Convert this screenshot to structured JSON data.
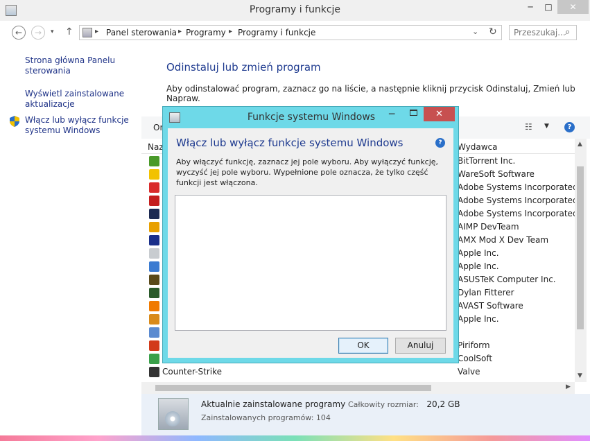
{
  "window": {
    "title": "Programy i funkcje",
    "minimize_glyph": "─",
    "maximize_glyph": "□",
    "close_glyph": "✕"
  },
  "navbar": {
    "back_glyph": "←",
    "forward_glyph": "→",
    "history_glyph": "▾",
    "up_glyph": "↑",
    "breadcrumb": [
      "Panel sterowania",
      "Programy",
      "Programy i funkcje"
    ],
    "separator_glyph": "▸",
    "dropdown_glyph": "⌄",
    "refresh_glyph": "↻",
    "search_placeholder": "Przeszukaj...",
    "search_glyph": "⌕"
  },
  "leftpane": {
    "home_link": "Strona główna Panelu sterowania",
    "updates_link": "Wyświetl zainstalowane aktualizacje",
    "features_link": "Włącz lub wyłącz funkcje systemu Windows"
  },
  "main": {
    "title": "Odinstaluj lub zmień program",
    "description": "Aby odinstalować program, zaznacz go na liście, a następnie kliknij przycisk Odinstaluj, Zmień lub Napraw.",
    "toolbar": {
      "organize_label": "Or",
      "views_glyph": "☷",
      "views_dropdown_glyph": "▼",
      "help_glyph": "?"
    },
    "columns": {
      "name": "Naz",
      "publisher": "Wydawca"
    },
    "rows": [
      {
        "name": "",
        "publisher": "BitTorrent Inc.",
        "icon_color": "#4a9a2a",
        "icon": "utorrent-icon"
      },
      {
        "name": "",
        "publisher": "WareSoft Software",
        "icon_color": "#f2c200",
        "icon": "radiation-icon"
      },
      {
        "name": "",
        "publisher": "Adobe Systems Incorporated",
        "icon_color": "#d92b2b",
        "icon": "adobe-reader-icon"
      },
      {
        "name": "",
        "publisher": "Adobe Systems Incorporated",
        "icon_color": "#c41e1e",
        "icon": "adobe-flash-icon"
      },
      {
        "name": "",
        "publisher": "Adobe Systems Incorporated",
        "icon_color": "#1c2a52",
        "icon": "photoshop-icon"
      },
      {
        "name": "",
        "publisher": "AIMP DevTeam",
        "icon_color": "#e8a000",
        "icon": "aimp-icon"
      },
      {
        "name": "",
        "publisher": "AMX Mod X Dev Team",
        "icon_color": "#1a2f8a",
        "icon": "amxx-icon"
      },
      {
        "name": "",
        "publisher": "Apple Inc.",
        "icon_color": "#c8ccd0",
        "icon": "apple-shield-icon"
      },
      {
        "name": "",
        "publisher": "Apple Inc.",
        "icon_color": "#3b7bd1",
        "icon": "apple-update-icon"
      },
      {
        "name": "",
        "publisher": "ASUSTeK Computer Inc.",
        "icon_color": "#5a4a1a",
        "icon": "asus-icon"
      },
      {
        "name": "",
        "publisher": "Dylan Fitterer",
        "icon_color": "#2a5a2a",
        "icon": "audiosurf-icon"
      },
      {
        "name": "",
        "publisher": "AVAST Software",
        "icon_color": "#f07a00",
        "icon": "avast-icon"
      },
      {
        "name": "",
        "publisher": "Apple Inc.",
        "icon_color": "#d98a1a",
        "icon": "bonjour-icon"
      },
      {
        "name": "",
        "publisher": "",
        "icon_color": "#5a8ad0",
        "icon": "app-window-icon"
      },
      {
        "name": "",
        "publisher": "Piriform",
        "icon_color": "#d23a1a",
        "icon": "ccleaner-icon"
      },
      {
        "name": "",
        "publisher": "CoolSoft",
        "icon_color": "#3aa04a",
        "icon": "music-note-icon"
      },
      {
        "name": "Counter-Strike",
        "publisher": "Valve",
        "icon_color": "#333333",
        "icon": "counter-strike-icon"
      }
    ],
    "scroll_up_glyph": "▲",
    "scroll_down_glyph": "▼",
    "scroll_right_glyph": "▶"
  },
  "details": {
    "title": "Aktualnie zainstalowane programy",
    "size_label": "Całkowity rozmiar:",
    "size_value": "20,2 GB",
    "count_text": "Zainstalowanych programów: 104"
  },
  "dialog": {
    "title": "Funkcje systemu Windows",
    "minimize_glyph": "─",
    "close_glyph": "✕",
    "heading": "Włącz lub wyłącz funkcje systemu Windows",
    "help_glyph": "?",
    "description": "Aby włączyć funkcję, zaznacz jej pole wyboru. Aby wyłączyć funkcję, wyczyść jej pole wyboru. Wypełnione pole oznacza, że tylko część funkcji jest włączona.",
    "ok_label": "OK",
    "cancel_label": "Anuluj"
  }
}
